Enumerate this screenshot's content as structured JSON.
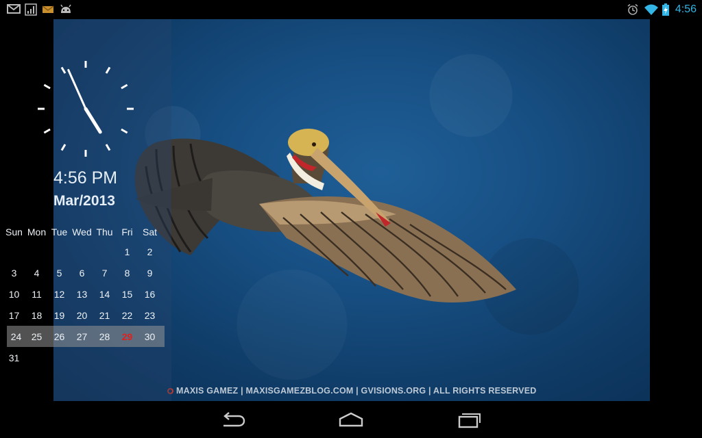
{
  "status_bar": {
    "time": "4:56",
    "left_icons": [
      "gmail-icon",
      "signal-icon",
      "email-icon",
      "android-icon"
    ],
    "right_icons": [
      "alarm-icon",
      "wifi-icon",
      "battery-icon"
    ],
    "accent_color": "#33b5e5"
  },
  "widget": {
    "time": "4:56 PM",
    "month_year": "Mar/2013",
    "clock": {
      "hour": 4,
      "minute": 56
    },
    "calendar": {
      "weekdays": [
        "Sun",
        "Mon",
        "Tue",
        "Wed",
        "Thu",
        "Fri",
        "Sat"
      ],
      "weeks": [
        [
          "",
          "",
          "",
          "",
          "",
          "1",
          "2"
        ],
        [
          "3",
          "4",
          "5",
          "6",
          "7",
          "8",
          "9"
        ],
        [
          "10",
          "11",
          "12",
          "13",
          "14",
          "15",
          "16"
        ],
        [
          "17",
          "18",
          "19",
          "20",
          "21",
          "22",
          "23"
        ],
        [
          "24",
          "25",
          "26",
          "27",
          "28",
          "29",
          "30"
        ],
        [
          "31",
          "",
          "",
          "",
          "",
          "",
          ""
        ]
      ],
      "current_week_index": 4,
      "today": "29",
      "today_color": "#e0201b"
    }
  },
  "wallpaper": {
    "watermark": "MAXIS GAMEZ | MAXISGAMEZBLOG.COM | GVISIONS.ORG | ALL RIGHTS RESERVED",
    "subject": "pelican-in-flight"
  },
  "nav_bar": {
    "buttons": [
      "back-icon",
      "home-icon",
      "recent-apps-icon"
    ]
  }
}
